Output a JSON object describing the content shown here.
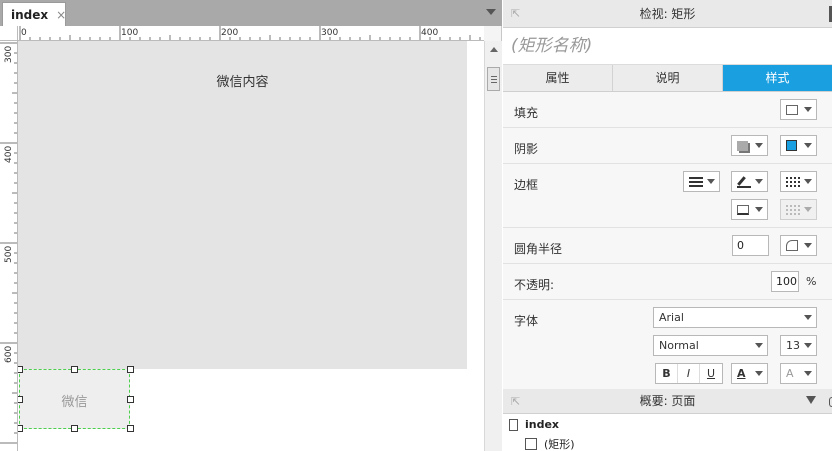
{
  "editor": {
    "tab": {
      "label": "index",
      "close_glyph": "×"
    },
    "ruler_h_labels": [
      "0",
      "100",
      "200",
      "300",
      "400"
    ],
    "ruler_v_labels": [
      "300",
      "400",
      "500",
      "600"
    ],
    "canvas": {
      "big_rect_label": "微信内容",
      "selected_rect_label": "微信"
    }
  },
  "inspector": {
    "header_title": "检视: 矩形",
    "shape_name_placeholder": "(矩形名称)",
    "tabs": [
      {
        "label": "属性",
        "active": false
      },
      {
        "label": "说明",
        "active": false
      },
      {
        "label": "样式",
        "active": true
      }
    ],
    "rows": {
      "fill": {
        "label": "填充"
      },
      "shadow": {
        "label": "阴影"
      },
      "border": {
        "label": "边框"
      },
      "radius": {
        "label": "圆角半径",
        "value": "0"
      },
      "opacity": {
        "label": "不透明:",
        "value": "100",
        "unit": "%"
      },
      "font": {
        "label": "字体",
        "family": "Arial",
        "weight": "Normal",
        "size": "13",
        "bold": "B",
        "italic": "I",
        "underline": "U",
        "color_glyph": "A",
        "effect_glyph": "A"
      }
    },
    "accent_color": "#1a9fe0"
  },
  "outline": {
    "header_title": "概要: 页面",
    "page_name": "index",
    "shape_name": "(矩形)"
  }
}
